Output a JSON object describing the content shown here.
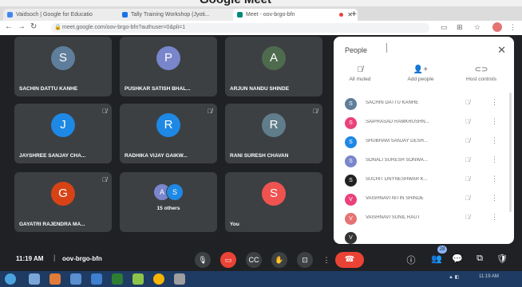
{
  "page_heading": "Google Meet",
  "browser": {
    "tabs": [
      {
        "label": "Vaidsoch | Google for Educatio",
        "color": "#4285f4"
      },
      {
        "label": "Tally Training Workshop (Jyoti...",
        "color": "#1a73e8"
      },
      {
        "label": "Meet - oov-brgo-bfn",
        "color": "#00897b"
      }
    ],
    "url": "meet.google.com/oov-brgo-bfn?authuser=0&pli=1"
  },
  "tiles": [
    {
      "initial": "S",
      "name": "SACHIN DATTU KANHE",
      "color": "#5f7e9c",
      "muted": false
    },
    {
      "initial": "P",
      "name": "PUSHKAR SATISH BHAL...",
      "color": "#7986cb",
      "muted": false
    },
    {
      "initial": "A",
      "name": "ARJUN NANDU SHINDE",
      "color": "#4e6b4e",
      "muted": false
    },
    {
      "initial": "J",
      "name": "JAYSHREE SANJAY CHA...",
      "color": "#1e88e5",
      "muted": true
    },
    {
      "initial": "R",
      "name": "RADHIKA VIJAY GAIKW...",
      "color": "#1e88e5",
      "muted": true
    },
    {
      "initial": "R",
      "name": "RANI SURESH CHAVAN",
      "color": "#607d8b",
      "muted": true
    },
    {
      "initial": "G",
      "name": "GAYATRI RAJENDRA MA...",
      "color": "#d84315",
      "muted": true
    },
    {
      "initial": "S",
      "name": "You",
      "color": "#ef5350",
      "muted": false
    }
  ],
  "others": {
    "label": "15 others",
    "a": "A",
    "b": "S"
  },
  "people_panel": {
    "title": "People",
    "actions": [
      "All muted",
      "Add people",
      "Host controls"
    ],
    "participants": [
      {
        "initial": "S",
        "name": "SACHIN DATTU KANHE",
        "color": "#5f7e9c"
      },
      {
        "initial": "S",
        "name": "SAIPRASAD RAMKRUSHN...",
        "color": "#ec407a"
      },
      {
        "initial": "S",
        "name": "SHUBHAM SANJAY DESH...",
        "color": "#1e88e5"
      },
      {
        "initial": "S",
        "name": "SONALI SURESH SONWA...",
        "color": "#7986cb"
      },
      {
        "initial": "S",
        "name": "SUCHIT DNYNESHWAR K...",
        "color": "#222222"
      },
      {
        "initial": "V",
        "name": "VAISHNAVI NITIN SHINDE",
        "color": "#ec407a"
      },
      {
        "initial": "V",
        "name": "VAISHNAVI SUNIL RAUT",
        "color": "#e57373"
      },
      {
        "initial": "V",
        "name": "",
        "color": "#333333"
      }
    ]
  },
  "bar": {
    "time": "11:19 AM",
    "code": "oov-brgo-bfn",
    "people_count": "28"
  },
  "taskbar": {
    "clock": "11:19 AM"
  }
}
